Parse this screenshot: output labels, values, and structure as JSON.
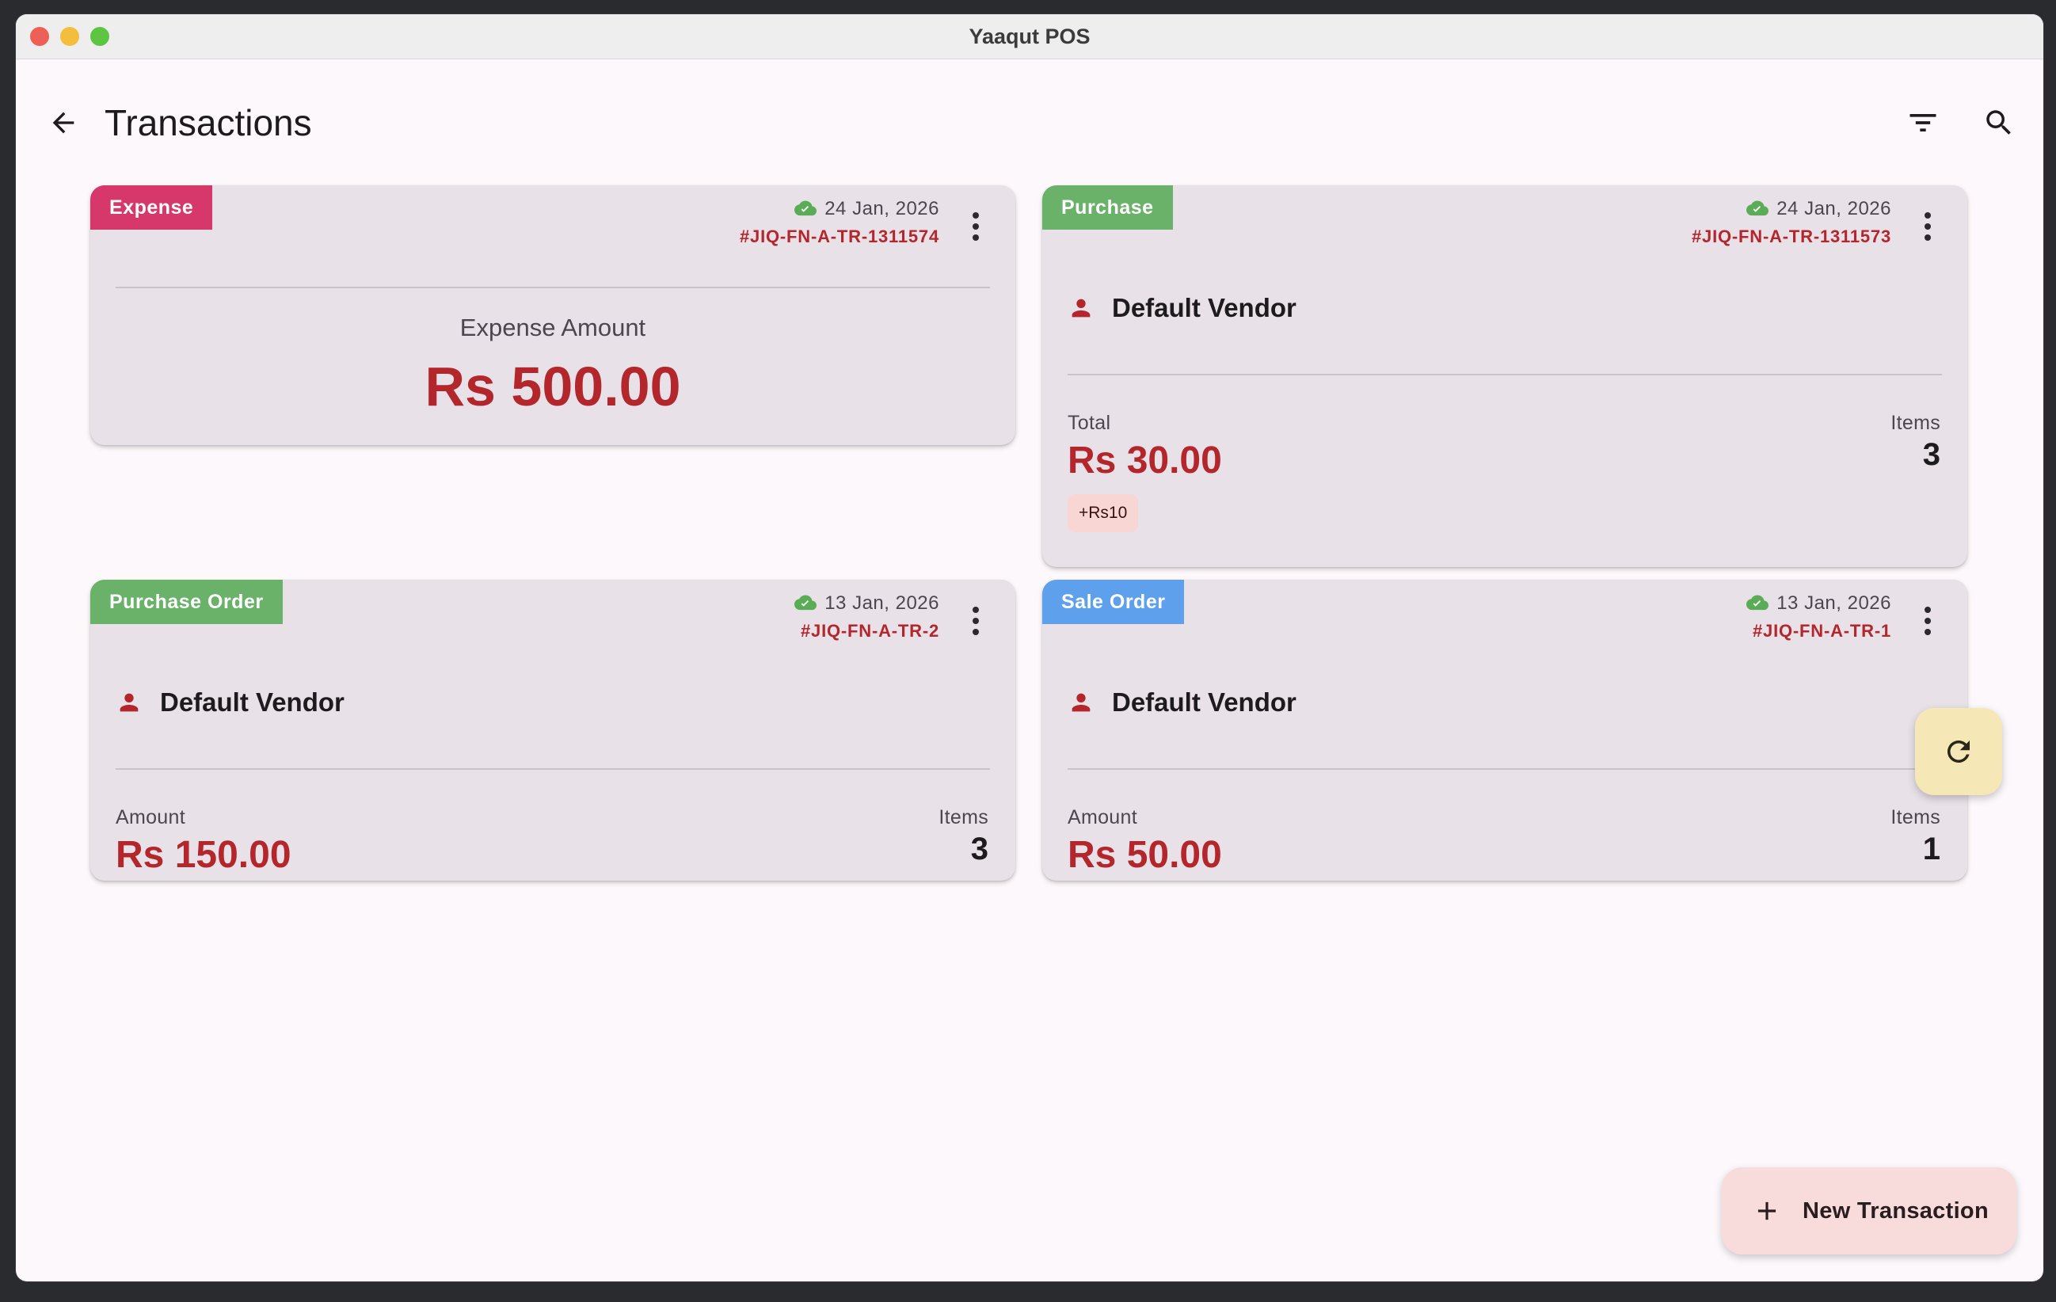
{
  "window": {
    "title": "Yaaqut POS"
  },
  "appbar": {
    "title": "Transactions",
    "back_icon": "arrow-left-icon",
    "filter_icon": "filter-icon",
    "search_icon": "search-icon"
  },
  "colors": {
    "expense": "#d6386b",
    "purchase": "#6ab169",
    "sale": "#5ea0eb",
    "amount": "#b3262c",
    "sync": "#5aac56"
  },
  "transactions": [
    {
      "type": "Expense",
      "date": "24 Jan, 2026",
      "ref": "#JIQ-FN-A-TR-1311574",
      "amount_label": "Expense Amount",
      "amount": "Rs 500.00"
    },
    {
      "type": "Purchase",
      "date": "24 Jan, 2026",
      "ref": "#JIQ-FN-A-TR-1311573",
      "vendor": "Default Vendor",
      "amount_label": "Total",
      "amount": "Rs 30.00",
      "items_label": "Items",
      "items": "3",
      "chip": "+Rs10"
    },
    {
      "type": "Purchase Order",
      "date": "13 Jan, 2026",
      "ref": "#JIQ-FN-A-TR-2",
      "vendor": "Default Vendor",
      "amount_label": "Amount",
      "amount": "Rs 150.00",
      "items_label": "Items",
      "items": "3"
    },
    {
      "type": "Sale Order",
      "date": "13 Jan, 2026",
      "ref": "#JIQ-FN-A-TR-1",
      "vendor": "Default Vendor",
      "amount_label": "Amount",
      "amount": "Rs 50.00",
      "items_label": "Items",
      "items": "1"
    }
  ],
  "fab": {
    "label": "New Transaction",
    "refresh_icon": "refresh-icon",
    "add_icon": "plus-icon"
  }
}
